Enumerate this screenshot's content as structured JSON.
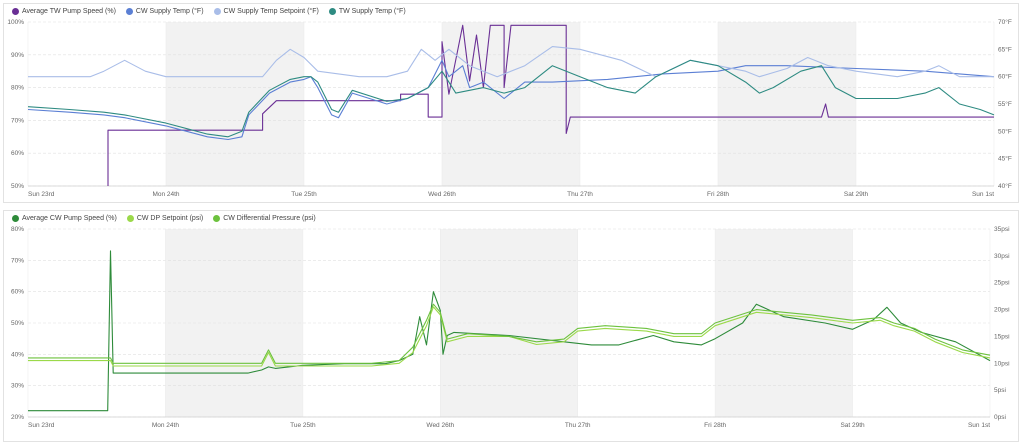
{
  "chart_data": [
    {
      "type": "line",
      "x_labels": [
        "Sun 23rd",
        "Mon 24th",
        "Tue 25th",
        "Wed 26th",
        "Thu 27th",
        "Fri 28th",
        "Sat 29th",
        "Sun 1st"
      ],
      "y_left": {
        "ticks": [
          "50%",
          "60%",
          "70%",
          "80%",
          "90%",
          "100%"
        ],
        "range": [
          50,
          100
        ]
      },
      "y_right": {
        "ticks": [
          "40°F",
          "45°F",
          "50°F",
          "55°F",
          "60°F",
          "65°F",
          "70°F"
        ],
        "range": [
          40,
          70
        ]
      },
      "shaded_days": [
        1,
        3,
        5
      ],
      "series": [
        {
          "name": "Average TW Pump Speed (%)",
          "color": "#6a2f95",
          "axis": "left",
          "points": [
            [
              0.58,
              50
            ],
            [
              0.58,
              67
            ],
            [
              1.7,
              67
            ],
            [
              1.7,
              72
            ],
            [
              1.8,
              76
            ],
            [
              2.7,
              76
            ],
            [
              2.7,
              78
            ],
            [
              2.9,
              78
            ],
            [
              2.9,
              71
            ],
            [
              3.0,
              71
            ],
            [
              3.0,
              94
            ],
            [
              3.05,
              78
            ],
            [
              3.15,
              99
            ],
            [
              3.2,
              82
            ],
            [
              3.25,
              96
            ],
            [
              3.3,
              80
            ],
            [
              3.35,
              99
            ],
            [
              3.45,
              99
            ],
            [
              3.45,
              80
            ],
            [
              3.5,
              99
            ],
            [
              3.9,
              99
            ],
            [
              3.9,
              66
            ],
            [
              3.93,
              71
            ],
            [
              5.75,
              71
            ],
            [
              5.78,
              75
            ],
            [
              5.8,
              71
            ],
            [
              7.0,
              71
            ]
          ]
        },
        {
          "name": "CW Supply Temp (°F)",
          "color": "#5b7fd4",
          "axis": "right",
          "points": [
            [
              0,
              54
            ],
            [
              0.3,
              53.5
            ],
            [
              0.55,
              53
            ],
            [
              0.7,
              52.5
            ],
            [
              1.0,
              51
            ],
            [
              1.3,
              49
            ],
            [
              1.45,
              48.5
            ],
            [
              1.55,
              49
            ],
            [
              1.6,
              53
            ],
            [
              1.75,
              57
            ],
            [
              1.9,
              59
            ],
            [
              2.0,
              59.5
            ],
            [
              2.05,
              60
            ],
            [
              2.1,
              58
            ],
            [
              2.2,
              53
            ],
            [
              2.25,
              52.5
            ],
            [
              2.35,
              57
            ],
            [
              2.6,
              55
            ],
            [
              2.75,
              56
            ],
            [
              2.9,
              58
            ],
            [
              3.0,
              63
            ],
            [
              3.05,
              60
            ],
            [
              3.15,
              62
            ],
            [
              3.2,
              58
            ],
            [
              3.3,
              59
            ],
            [
              3.45,
              56
            ],
            [
              3.6,
              59
            ],
            [
              3.8,
              59
            ],
            [
              4.2,
              59.5
            ],
            [
              4.6,
              60.5
            ],
            [
              5.0,
              61
            ],
            [
              5.2,
              62
            ],
            [
              5.5,
              62
            ],
            [
              6.0,
              61.5
            ],
            [
              6.5,
              61
            ],
            [
              7.0,
              60
            ]
          ]
        },
        {
          "name": "CW Supply Temp Setpoint (°F)",
          "color": "#a9bde8",
          "axis": "right",
          "points": [
            [
              0,
              60
            ],
            [
              0.45,
              60
            ],
            [
              0.55,
              61
            ],
            [
              0.7,
              63
            ],
            [
              0.85,
              61
            ],
            [
              1.0,
              60
            ],
            [
              1.7,
              60
            ],
            [
              1.8,
              63
            ],
            [
              1.9,
              65
            ],
            [
              2.0,
              63.5
            ],
            [
              2.1,
              61
            ],
            [
              2.4,
              60
            ],
            [
              2.6,
              60
            ],
            [
              2.75,
              61
            ],
            [
              2.85,
              65
            ],
            [
              2.95,
              63
            ],
            [
              3.05,
              65
            ],
            [
              3.2,
              62
            ],
            [
              3.4,
              60
            ],
            [
              3.6,
              62
            ],
            [
              3.8,
              65.5
            ],
            [
              4.0,
              65
            ],
            [
              4.3,
              63
            ],
            [
              4.55,
              60
            ],
            [
              4.8,
              63
            ],
            [
              5.0,
              62
            ],
            [
              5.2,
              61
            ],
            [
              5.3,
              60
            ],
            [
              5.5,
              61.5
            ],
            [
              5.65,
              63.5
            ],
            [
              5.8,
              62
            ],
            [
              6.0,
              61
            ],
            [
              6.3,
              60
            ],
            [
              6.5,
              61
            ],
            [
              6.6,
              62
            ],
            [
              6.75,
              60
            ],
            [
              7.0,
              60
            ]
          ]
        },
        {
          "name": "TW Supply Temp (°F)",
          "color": "#2e8b82",
          "axis": "right",
          "points": [
            [
              0,
              54.5
            ],
            [
              0.3,
              54
            ],
            [
              0.55,
              53.5
            ],
            [
              0.7,
              53
            ],
            [
              1.0,
              51.5
            ],
            [
              1.3,
              49.5
            ],
            [
              1.45,
              49
            ],
            [
              1.55,
              50
            ],
            [
              1.6,
              53.5
            ],
            [
              1.75,
              57.5
            ],
            [
              1.9,
              59.5
            ],
            [
              2.0,
              60
            ],
            [
              2.05,
              60
            ],
            [
              2.1,
              59
            ],
            [
              2.2,
              54
            ],
            [
              2.25,
              53.5
            ],
            [
              2.35,
              57.5
            ],
            [
              2.6,
              55.5
            ],
            [
              2.75,
              56
            ],
            [
              2.9,
              58
            ],
            [
              3.0,
              61
            ],
            [
              3.1,
              57
            ],
            [
              3.3,
              58
            ],
            [
              3.45,
              57
            ],
            [
              3.6,
              58
            ],
            [
              3.8,
              62
            ],
            [
              4.0,
              60
            ],
            [
              4.2,
              58
            ],
            [
              4.4,
              57
            ],
            [
              4.55,
              60
            ],
            [
              4.8,
              63
            ],
            [
              5.0,
              62
            ],
            [
              5.2,
              59
            ],
            [
              5.3,
              57
            ],
            [
              5.4,
              58
            ],
            [
              5.6,
              61
            ],
            [
              5.75,
              62
            ],
            [
              5.85,
              58
            ],
            [
              6.0,
              56
            ],
            [
              6.3,
              56
            ],
            [
              6.5,
              57
            ],
            [
              6.6,
              58
            ],
            [
              6.75,
              55
            ],
            [
              6.9,
              54
            ],
            [
              7.0,
              53
            ]
          ]
        }
      ]
    },
    {
      "type": "line",
      "x_labels": [
        "Sun 23rd",
        "Mon 24th",
        "Tue 25th",
        "Wed 26th",
        "Thu 27th",
        "Fri 28th",
        "Sat 29th",
        "Sun 1st"
      ],
      "y_left": {
        "ticks": [
          "20%",
          "30%",
          "40%",
          "50%",
          "60%",
          "70%",
          "80%"
        ],
        "range": [
          20,
          80
        ]
      },
      "y_right": {
        "ticks": [
          "0psi",
          "5psi",
          "10psi",
          "15psi",
          "20psi",
          "25psi",
          "30psi",
          "35psi"
        ],
        "range": [
          0,
          35
        ]
      },
      "shaded_days": [
        1,
        3,
        5
      ],
      "series": [
        {
          "name": "Average CW Pump Speed (%)",
          "color": "#2e8b3a",
          "axis": "left",
          "points": [
            [
              0,
              22
            ],
            [
              0.58,
              22
            ],
            [
              0.6,
              73
            ],
            [
              0.62,
              34
            ],
            [
              1.5,
              34
            ],
            [
              1.6,
              34
            ],
            [
              1.7,
              35
            ],
            [
              1.75,
              36
            ],
            [
              1.8,
              35.5
            ],
            [
              2.0,
              36.5
            ],
            [
              2.3,
              37
            ],
            [
              2.6,
              37
            ],
            [
              2.7,
              38
            ],
            [
              2.8,
              40
            ],
            [
              2.85,
              52
            ],
            [
              2.9,
              43
            ],
            [
              2.95,
              60
            ],
            [
              3.0,
              54
            ],
            [
              3.02,
              40
            ],
            [
              3.05,
              46
            ],
            [
              3.1,
              47
            ],
            [
              3.5,
              46
            ],
            [
              3.9,
              44
            ],
            [
              4.1,
              43
            ],
            [
              4.3,
              43
            ],
            [
              4.55,
              46
            ],
            [
              4.7,
              44
            ],
            [
              4.9,
              43
            ],
            [
              5.0,
              45
            ],
            [
              5.2,
              50
            ],
            [
              5.3,
              56
            ],
            [
              5.4,
              54
            ],
            [
              5.5,
              52
            ],
            [
              5.8,
              50
            ],
            [
              6.0,
              48
            ],
            [
              6.15,
              51
            ],
            [
              6.25,
              55
            ],
            [
              6.35,
              50
            ],
            [
              6.5,
              47
            ],
            [
              6.75,
              44
            ],
            [
              7.0,
              38
            ]
          ]
        },
        {
          "name": "CW DP Setpoint (psi)",
          "color": "#9bd94a",
          "axis": "right",
          "points": [
            [
              0,
              10.5
            ],
            [
              0.6,
              10.5
            ],
            [
              0.62,
              9.5
            ],
            [
              1.5,
              9.5
            ],
            [
              1.7,
              9.5
            ],
            [
              1.75,
              12
            ],
            [
              1.8,
              9.5
            ],
            [
              2.5,
              9.5
            ],
            [
              2.7,
              10
            ],
            [
              2.8,
              12
            ],
            [
              2.9,
              17
            ],
            [
              2.95,
              20.5
            ],
            [
              3.0,
              19
            ],
            [
              3.05,
              14
            ],
            [
              3.2,
              15
            ],
            [
              3.5,
              15
            ],
            [
              3.7,
              13.5
            ],
            [
              3.9,
              14
            ],
            [
              4.0,
              16
            ],
            [
              4.2,
              16.5
            ],
            [
              4.5,
              16
            ],
            [
              4.7,
              15
            ],
            [
              4.9,
              15
            ],
            [
              5.0,
              17
            ],
            [
              5.3,
              19.5
            ],
            [
              5.5,
              19
            ],
            [
              5.7,
              18.5
            ],
            [
              6.0,
              17.5
            ],
            [
              6.2,
              18
            ],
            [
              6.3,
              17
            ],
            [
              6.45,
              16
            ],
            [
              6.6,
              14
            ],
            [
              6.8,
              12
            ],
            [
              7.0,
              11
            ]
          ]
        },
        {
          "name": "CW Differential Pressure (psi)",
          "color": "#6dc23e",
          "axis": "right",
          "points": [
            [
              0,
              11
            ],
            [
              0.6,
              11
            ],
            [
              0.62,
              10
            ],
            [
              1.5,
              10
            ],
            [
              1.7,
              10
            ],
            [
              1.75,
              12.5
            ],
            [
              1.8,
              10
            ],
            [
              2.5,
              10
            ],
            [
              2.7,
              10.5
            ],
            [
              2.8,
              13
            ],
            [
              2.9,
              18
            ],
            [
              2.95,
              21
            ],
            [
              3.0,
              19.5
            ],
            [
              3.05,
              14.5
            ],
            [
              3.2,
              15.5
            ],
            [
              3.5,
              15
            ],
            [
              3.7,
              14
            ],
            [
              3.9,
              14.5
            ],
            [
              4.0,
              16.5
            ],
            [
              4.2,
              17
            ],
            [
              4.5,
              16.5
            ],
            [
              4.7,
              15.5
            ],
            [
              4.9,
              15.5
            ],
            [
              5.0,
              17.5
            ],
            [
              5.3,
              20
            ],
            [
              5.5,
              19.5
            ],
            [
              5.7,
              19
            ],
            [
              6.0,
              18
            ],
            [
              6.2,
              18.5
            ],
            [
              6.3,
              17.5
            ],
            [
              6.45,
              16.5
            ],
            [
              6.6,
              14.5
            ],
            [
              6.8,
              12.5
            ],
            [
              7.0,
              11.5
            ]
          ]
        }
      ]
    }
  ]
}
